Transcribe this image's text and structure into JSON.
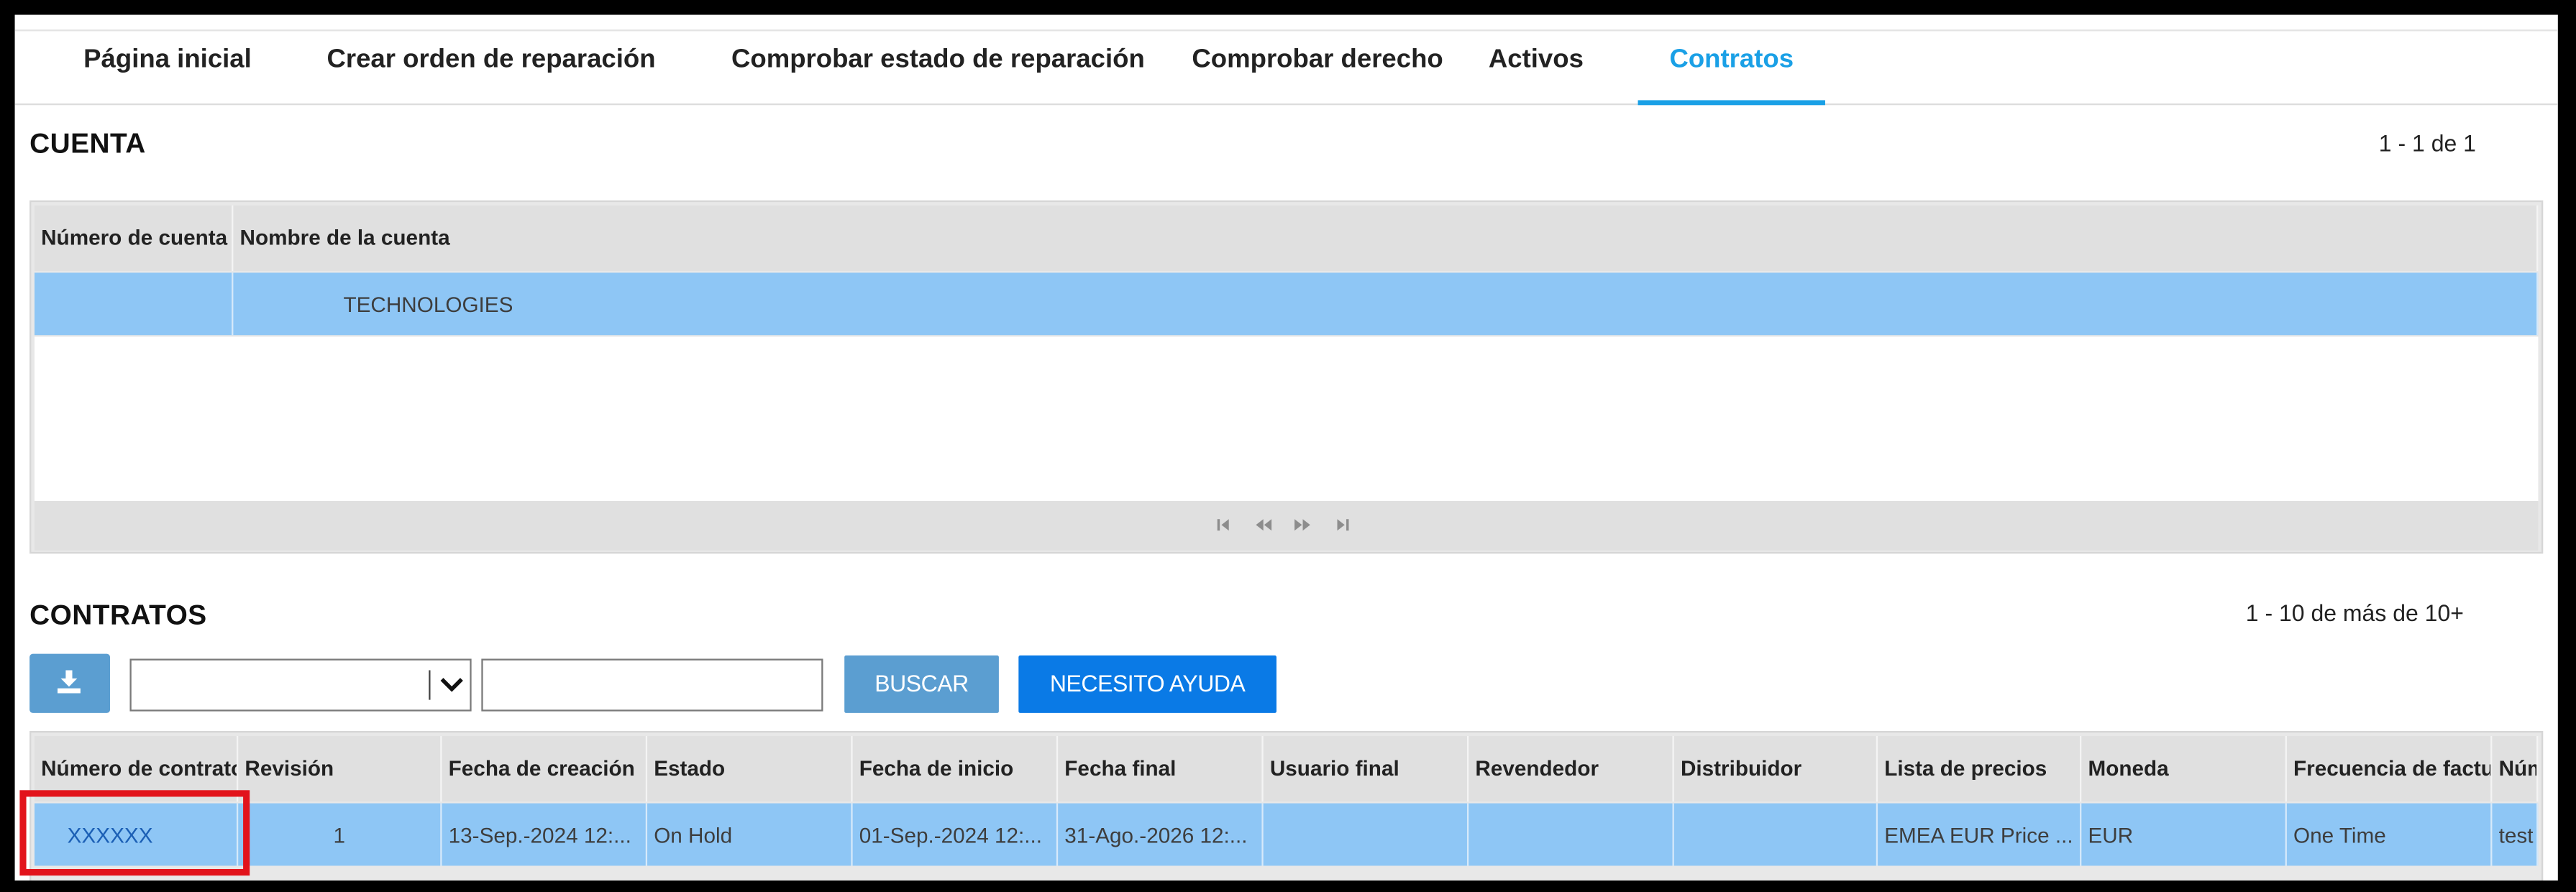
{
  "tabs": [
    {
      "label": "Página inicial",
      "active": false
    },
    {
      "label": "Crear orden de reparación",
      "active": false
    },
    {
      "label": "Comprobar estado de reparación",
      "active": false
    },
    {
      "label": "Comprobar derecho",
      "active": false
    },
    {
      "label": "Activos",
      "active": false
    },
    {
      "label": "Contratos",
      "active": true
    }
  ],
  "colors": {
    "accent": "#1aa0e6",
    "row_selected": "#8ec6f5",
    "primary_button": "#0a7ae6",
    "secondary_button": "#5b9ed1",
    "highlight": "#e2131b"
  },
  "account": {
    "title": "CUENTA",
    "pager": "1 - 1 de 1",
    "columns": [
      "Número de cuenta",
      "Nombre de la cuenta"
    ],
    "rows": [
      {
        "number": "",
        "name": "TECHNOLOGIES"
      }
    ],
    "pagination_icons": [
      "first-page-icon",
      "previous-page-icon",
      "next-page-icon",
      "last-page-icon"
    ]
  },
  "contracts": {
    "title": "CONTRATOS",
    "pager": "1 - 10 de más de 10+",
    "toolbar": {
      "download_icon": "download-icon",
      "filter_value": "",
      "search_value": "",
      "search_label": "BUSCAR",
      "help_label": "NECESITO AYUDA"
    },
    "columns": [
      "Número de contrato",
      "Revisión",
      "Fecha de creación",
      "Estado",
      "Fecha de inicio",
      "Fecha final",
      "Usuario final",
      "Revendedor",
      "Distribuidor",
      "Lista de precios",
      "Moneda",
      "Frecuencia de factu",
      "Núm"
    ],
    "rows": [
      {
        "contract_number": "XXXXXX",
        "revision": "1",
        "created": "13-Sep.-2024 12:...",
        "status": "On Hold",
        "start": "01-Sep.-2024 12:...",
        "end": "31-Ago.-2026 12:...",
        "end_user": "",
        "reseller": "",
        "distributor": "",
        "price_list": "EMEA EUR Price ...",
        "currency": "EUR",
        "billing_frequency": "One Time",
        "num": "test"
      }
    ]
  }
}
